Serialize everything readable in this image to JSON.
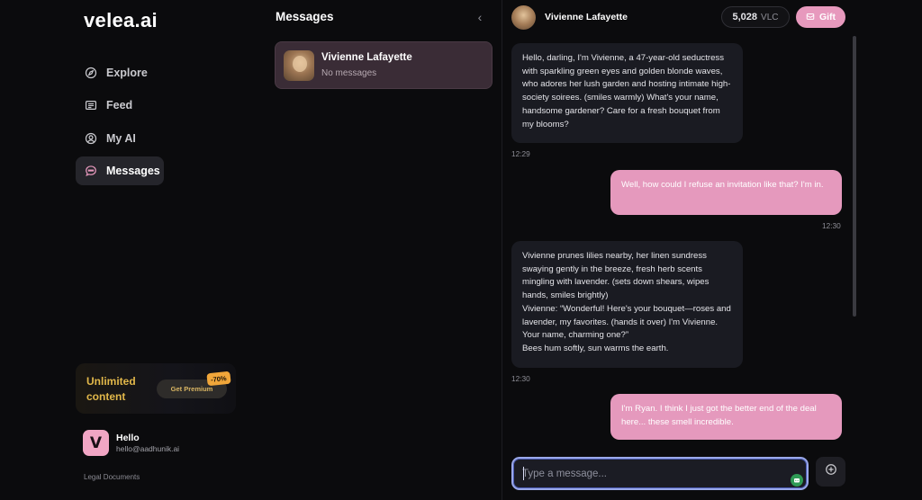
{
  "app": {
    "logo": "velea.ai"
  },
  "sidebar": {
    "items": [
      {
        "label": "Explore",
        "icon": "compass-icon"
      },
      {
        "label": "Feed",
        "icon": "feed-icon"
      },
      {
        "label": "My AI",
        "icon": "user-circle-icon"
      },
      {
        "label": "Messages",
        "icon": "chat-bubble-icon",
        "active": true
      }
    ],
    "promo": {
      "text": "Unlimited content",
      "button": "Get Premium",
      "badge": "-70%"
    },
    "profile": {
      "initial": "V",
      "name": "Hello",
      "email": "hello@aadhunik.ai"
    },
    "legal": "Legal Documents"
  },
  "messages_list": {
    "title": "Messages",
    "conversations": [
      {
        "name": "Vivienne Lafayette",
        "preview": "No messages"
      }
    ]
  },
  "chat": {
    "header": {
      "name": "Vivienne Lafayette",
      "balance": "5,028",
      "balance_unit": "VLC",
      "gift_label": "Gift"
    },
    "messages": [
      {
        "role": "ai",
        "text": "Hello, darling, I'm Vivienne, a 47-year-old seductress with sparkling green eyes and golden blonde waves, who adores her lush garden and hosting intimate high-society soirees. (smiles warmly) What's your name, handsome gardener? Care for a fresh bouquet from my blooms?",
        "time": "12:29"
      },
      {
        "role": "user",
        "text": "Well, how could I refuse an invitation like that? I'm in.",
        "time": "12:30"
      },
      {
        "role": "ai",
        "text": "Vivienne prunes lilies nearby, her linen sundress swaying gently in the breeze, fresh herb scents mingling with lavender. (sets down shears, wipes hands, smiles brightly)\nVivienne: “Wonderful! Here's your bouquet—roses and lavender, my favorites. (hands it over) I'm Vivienne. Your name, charming one?”\nBees hum softly, sun warms the earth.",
        "time": "12:30"
      },
      {
        "role": "user",
        "text": "I'm Ryan. I think I just got the better end of the deal here... these smell incredible.",
        "time": ""
      }
    ],
    "composer": {
      "placeholder": "Type a message...",
      "value": ""
    }
  },
  "colors": {
    "accent_pink": "#e599bd",
    "promo_gold": "#e2b84a",
    "focus_blue": "#9aa8ea"
  }
}
